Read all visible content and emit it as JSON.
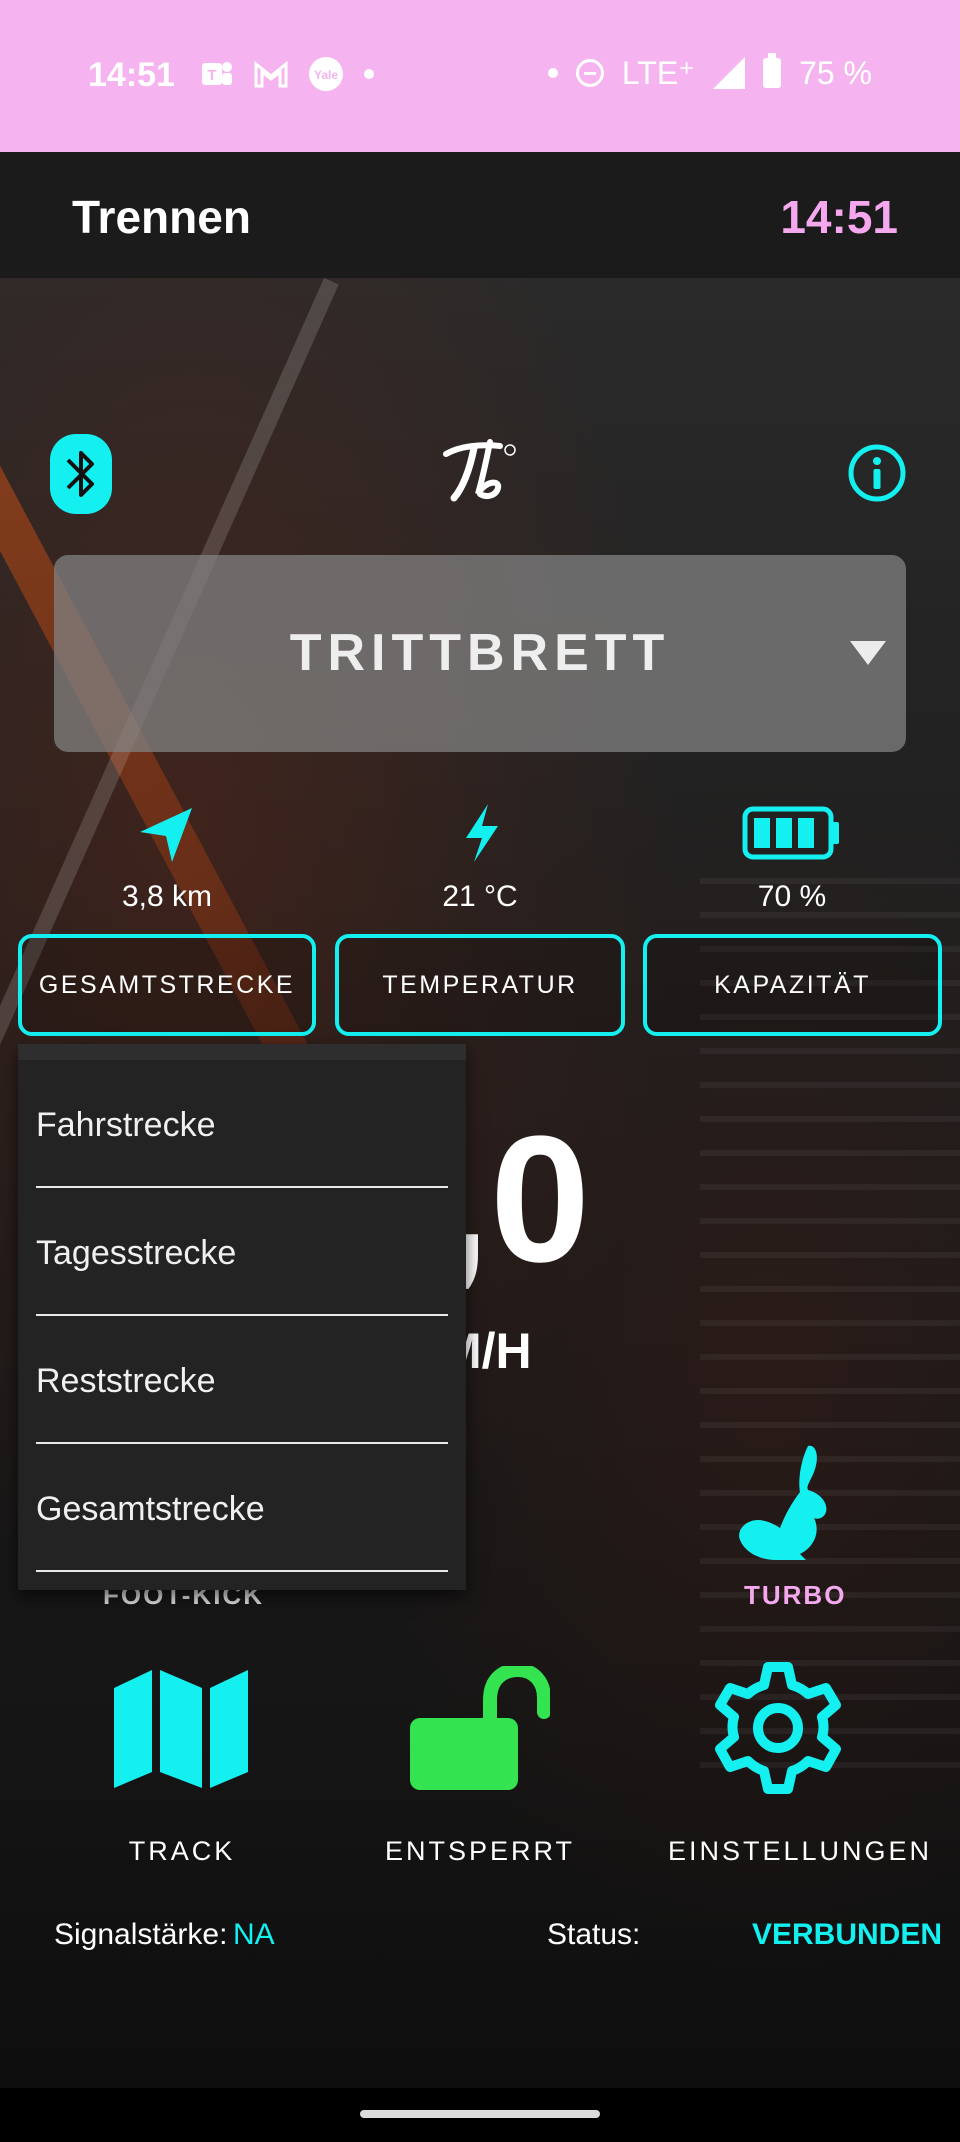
{
  "status_bar": {
    "time": "14:51",
    "notification_icons": [
      "teams-icon",
      "gmail-icon",
      "yale-icon"
    ],
    "network": "LTE⁺",
    "battery": "75 %"
  },
  "app_bar": {
    "title": "Trennen",
    "time": "14:51"
  },
  "device": {
    "name": "TRITTBRETT",
    "logo": "Tb"
  },
  "stats": [
    {
      "value": "3,8 km",
      "button": "GESAMTSTRECKE",
      "icon": "navigation-arrow-icon"
    },
    {
      "value": "21 °C",
      "button": "TEMPERATUR",
      "icon": "lightning-icon"
    },
    {
      "value": "70 %",
      "button": "KAPAZITÄT",
      "icon": "battery-icon"
    }
  ],
  "speed": {
    "value": ",0",
    "unit": "M/H"
  },
  "modes": {
    "left": "FOOT-KICK",
    "right": "TURBO"
  },
  "actions": [
    {
      "label": "TRACK",
      "icon": "map-icon"
    },
    {
      "label": "ENTSPERRT",
      "icon": "unlocked-icon"
    },
    {
      "label": "EINSTELLUNGEN",
      "icon": "gear-icon"
    }
  ],
  "footer": {
    "signal_label": "Signalstärke:",
    "signal_value": "NA",
    "status_label": "Status:",
    "status_value": "VERBUNDEN"
  },
  "menu": {
    "items": [
      "Fahrstrecke",
      "Tagesstrecke",
      "Reststrecke",
      "Gesamtstrecke"
    ]
  },
  "colors": {
    "accent": "#14f0f0",
    "pink": "#f5a8ee",
    "green": "#33e34f"
  }
}
